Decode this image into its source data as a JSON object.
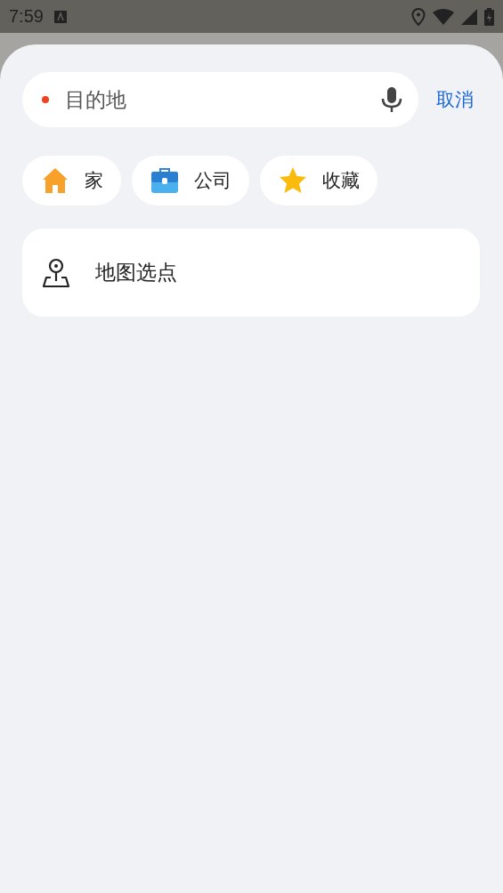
{
  "status_bar": {
    "time": "7:59"
  },
  "search": {
    "placeholder": "目的地"
  },
  "cancel": "取消",
  "shortcuts": [
    {
      "kind": "home",
      "label": "家"
    },
    {
      "kind": "work",
      "label": "公司"
    },
    {
      "kind": "favorite",
      "label": "收藏"
    }
  ],
  "map_pick": {
    "label": "地图选点"
  }
}
